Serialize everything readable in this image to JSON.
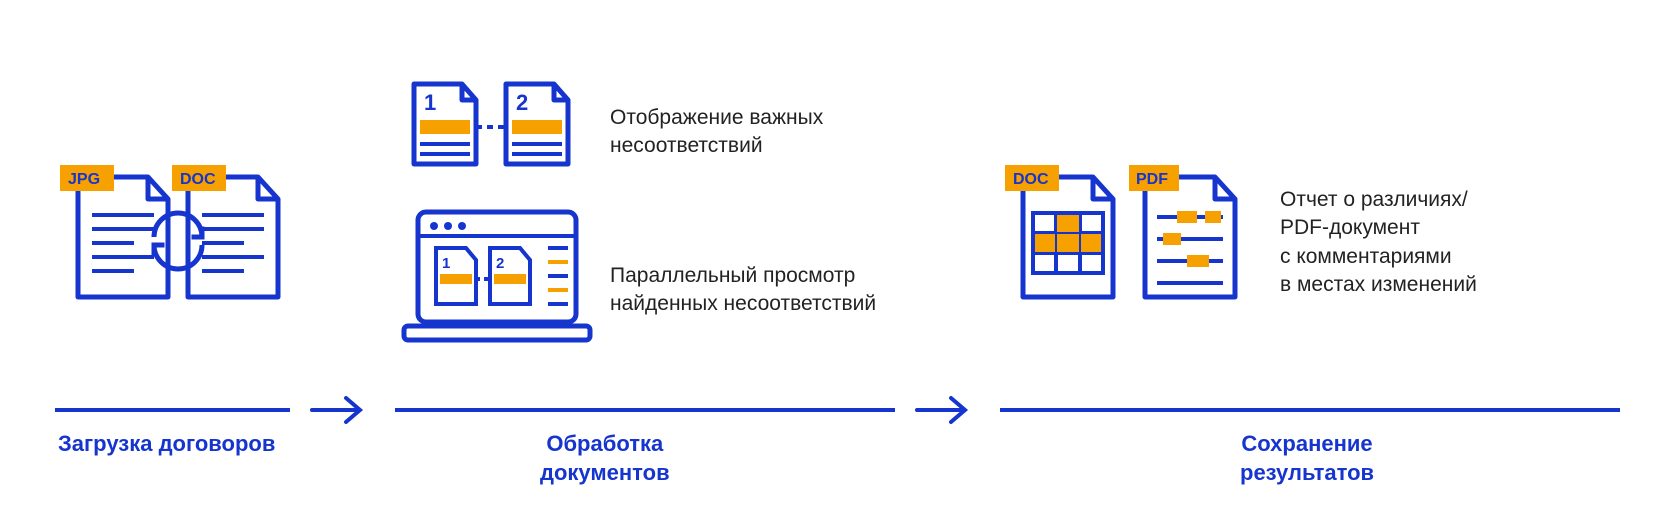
{
  "stages": {
    "upload": {
      "badge_left": "JPG",
      "badge_right": "DOC",
      "caption": "Загрузка договоров"
    },
    "process": {
      "pair_num_left": "1",
      "pair_num_right": "2",
      "desc_top": "Отображение важных\nнесоответствий",
      "desc_bottom": "Параллельный просмотр\nнайденных несоответствий",
      "caption": "Обработка\nдокументов"
    },
    "save": {
      "badge_left": "DOC",
      "badge_right": "PDF",
      "desc": "Отчет о различиях/\nPDF-документ\nс комментариями\nв местах изменений",
      "caption": "Сохранение\nрезультатов"
    }
  }
}
